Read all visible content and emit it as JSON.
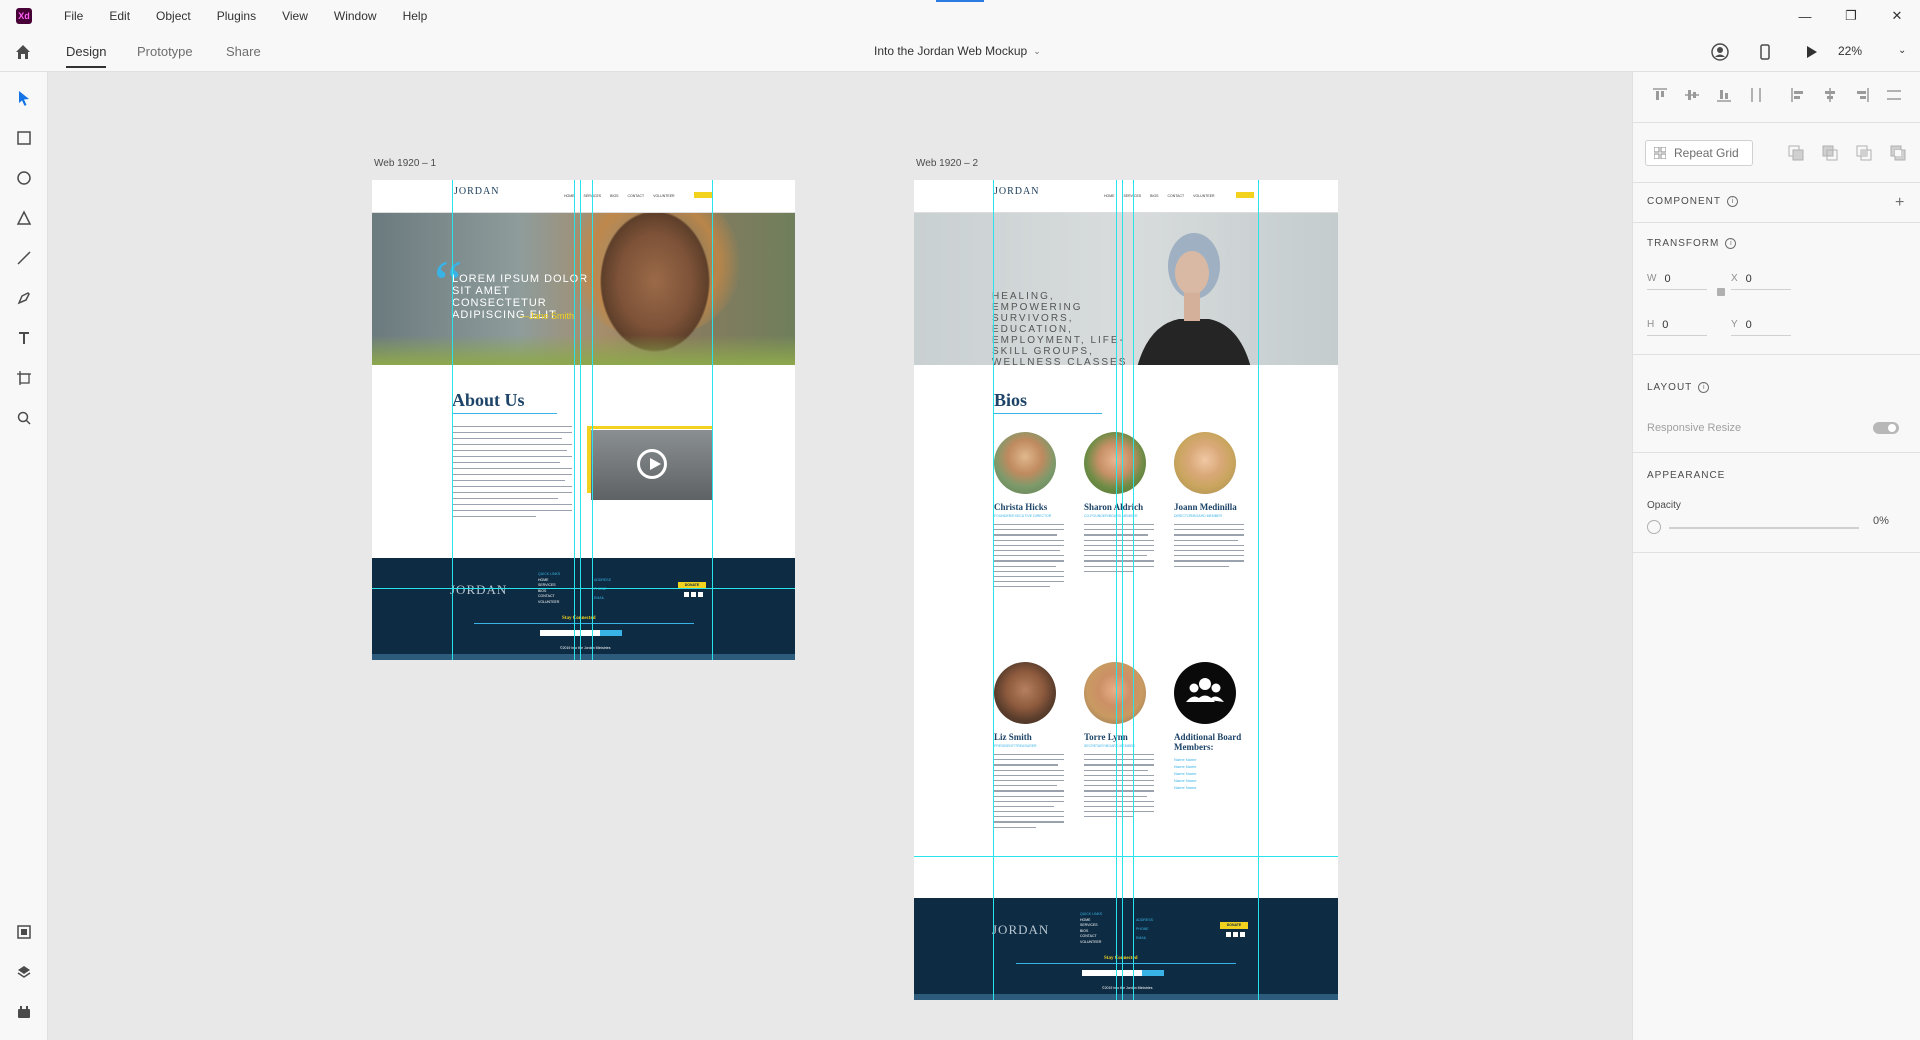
{
  "app": {
    "logo_text": "Xd",
    "menu": [
      "File",
      "Edit",
      "Object",
      "Plugins",
      "View",
      "Window",
      "Help"
    ],
    "window_controls": [
      "minimize",
      "restore",
      "close"
    ]
  },
  "toolbar": {
    "tabs": [
      "Design",
      "Prototype",
      "Share"
    ],
    "active_tab": "Design",
    "document_title": "Into the Jordan Web Mockup",
    "zoom": "22%"
  },
  "tools": [
    "select-icon",
    "rectangle-icon",
    "ellipse-icon",
    "polygon-icon",
    "line-icon",
    "pen-icon",
    "text-icon",
    "artboard-icon",
    "zoom-icon"
  ],
  "bottom_tools": [
    "assets-icon",
    "layers-icon",
    "plugins-icon"
  ],
  "artboards": [
    {
      "label": "Web 1920 – 1",
      "logo": "JORDAN",
      "nav_links": [
        "HOME",
        "SERVICES",
        "BIOS",
        "CONTACT",
        "VOLUNTEER"
      ],
      "quote": "LOREM IPSUM DOLOR SIT AMET CONSECTETUR ADIPISCING ELIT",
      "quote_author": "—Jane Smith",
      "section_title": "About Us",
      "footer": {
        "links_heading": "QUICK LINKS",
        "links": [
          "HOME",
          "SERVICES",
          "BIOS",
          "CONTACT",
          "VOLUNTEER"
        ],
        "contact_keys": [
          "ADDRESS",
          "PHONE",
          "EMAIL"
        ],
        "donate": "DONATE",
        "stay": "Stay Connected",
        "submit": "SUBMIT",
        "copyright": "©2019 Into the Jordan Ministries"
      }
    },
    {
      "label": "Web 1920 – 2",
      "logo": "JORDAN",
      "nav_links": [
        "HOME",
        "SERVICES",
        "BIOS",
        "CONTACT",
        "VOLUNTEER"
      ],
      "hero_text": "HEALING, EMPOWERING SURVIVORS, EDUCATION, EMPLOYMENT, LIFE-SKILL GROUPS, WELLNESS CLASSES",
      "section_title": "Bios",
      "bios": [
        {
          "name": "Christa Hicks",
          "role": "FOUNDER/EXECUTIVE DIRECTOR"
        },
        {
          "name": "Sharon Aldrich",
          "role": "CO-FOUNDER/BOARD MEMBER"
        },
        {
          "name": "Joann Medinilla",
          "role": "DIRECTOR/BOARD MEMBER"
        },
        {
          "name": "Liz Smith",
          "role": "PRESIDENT/TREASURER"
        },
        {
          "name": "Torre Lynn",
          "role": "SECRETARY/BOARD MEMBER"
        }
      ],
      "board": {
        "title": "Additional Board Members:",
        "members": [
          "Name Name",
          "Name Name",
          "Name Name",
          "Name Name",
          "Name Name"
        ]
      },
      "footer": {
        "links_heading": "QUICK LINKS",
        "links": [
          "HOME",
          "SERVICES",
          "BIOS",
          "CONTACT",
          "VOLUNTEER"
        ],
        "contact_keys": [
          "ADDRESS",
          "PHONE",
          "EMAIL"
        ],
        "donate": "DONATE",
        "stay": "Stay Connected",
        "submit": "SUBMIT",
        "copyright": "©2019 Into the Jordan Ministries"
      }
    }
  ],
  "panel": {
    "repeat_grid": "Repeat Grid",
    "component": "COMPONENT",
    "transform": "TRANSFORM",
    "w_label": "W",
    "w": "0",
    "x_label": "X",
    "x": "0",
    "h_label": "H",
    "h": "0",
    "y_label": "Y",
    "y": "0",
    "layout": "LAYOUT",
    "responsive_resize": "Responsive Resize",
    "appearance": "APPEARANCE",
    "opacity_label": "Opacity",
    "opacity": "0%"
  },
  "colors": {
    "guide": "#29e3ea",
    "navy": "#0d2b42",
    "brand_blue": "#1d4468",
    "accent_cyan": "#39b3e6",
    "accent_yellow": "#f2d21f"
  }
}
